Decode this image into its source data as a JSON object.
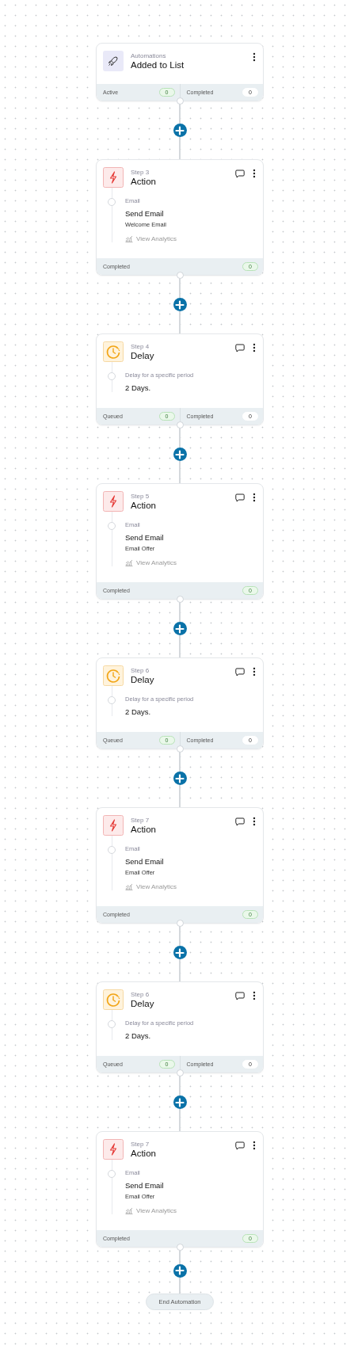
{
  "nodes": [
    {
      "kind": "trigger",
      "category": "Automations",
      "title": "Added to List",
      "stats": [
        {
          "label": "Active",
          "count": "0",
          "kind": "success"
        },
        {
          "label": "Completed",
          "count": "0",
          "kind": "neutral"
        }
      ]
    },
    {
      "kind": "action",
      "step": "Step 3",
      "title": "Action",
      "detail_label": "Email",
      "detail_title": "Send Email",
      "detail_sub": "Welcome Email",
      "link": "View Analytics",
      "stats": [
        {
          "label": "Completed",
          "count": "0",
          "kind": "success"
        }
      ]
    },
    {
      "kind": "delay",
      "step": "Step 4",
      "title": "Delay",
      "detail_label": "Delay for a specific period",
      "detail_title": "2 Days.",
      "stats": [
        {
          "label": "Queued",
          "count": "0",
          "kind": "success"
        },
        {
          "label": "Completed",
          "count": "0",
          "kind": "neutral"
        }
      ]
    },
    {
      "kind": "action",
      "step": "Step 5",
      "title": "Action",
      "detail_label": "Email",
      "detail_title": "Send Email",
      "detail_sub": "Email Offer",
      "link": "View Analytics",
      "stats": [
        {
          "label": "Completed",
          "count": "0",
          "kind": "success"
        }
      ]
    },
    {
      "kind": "delay",
      "step": "Step 6",
      "title": "Delay",
      "detail_label": "Delay for a specific period",
      "detail_title": "2 Days.",
      "stats": [
        {
          "label": "Queued",
          "count": "0",
          "kind": "success"
        },
        {
          "label": "Completed",
          "count": "0",
          "kind": "neutral"
        }
      ]
    },
    {
      "kind": "action",
      "step": "Step 7",
      "title": "Action",
      "detail_label": "Email",
      "detail_title": "Send Email",
      "detail_sub": "Email Offer",
      "link": "View Analytics",
      "stats": [
        {
          "label": "Completed",
          "count": "0",
          "kind": "success"
        }
      ]
    },
    {
      "kind": "delay",
      "step": "Step 6",
      "title": "Delay",
      "detail_label": "Delay for a specific period",
      "detail_title": "2 Days.",
      "stats": [
        {
          "label": "Queued",
          "count": "0",
          "kind": "success"
        },
        {
          "label": "Completed",
          "count": "0",
          "kind": "neutral"
        }
      ]
    },
    {
      "kind": "action",
      "step": "Step 7",
      "title": "Action",
      "detail_label": "Email",
      "detail_title": "Send Email",
      "detail_sub": "Email Offer",
      "link": "View Analytics",
      "stats": [
        {
          "label": "Completed",
          "count": "0",
          "kind": "success"
        }
      ]
    }
  ],
  "end_label": "End Automation"
}
